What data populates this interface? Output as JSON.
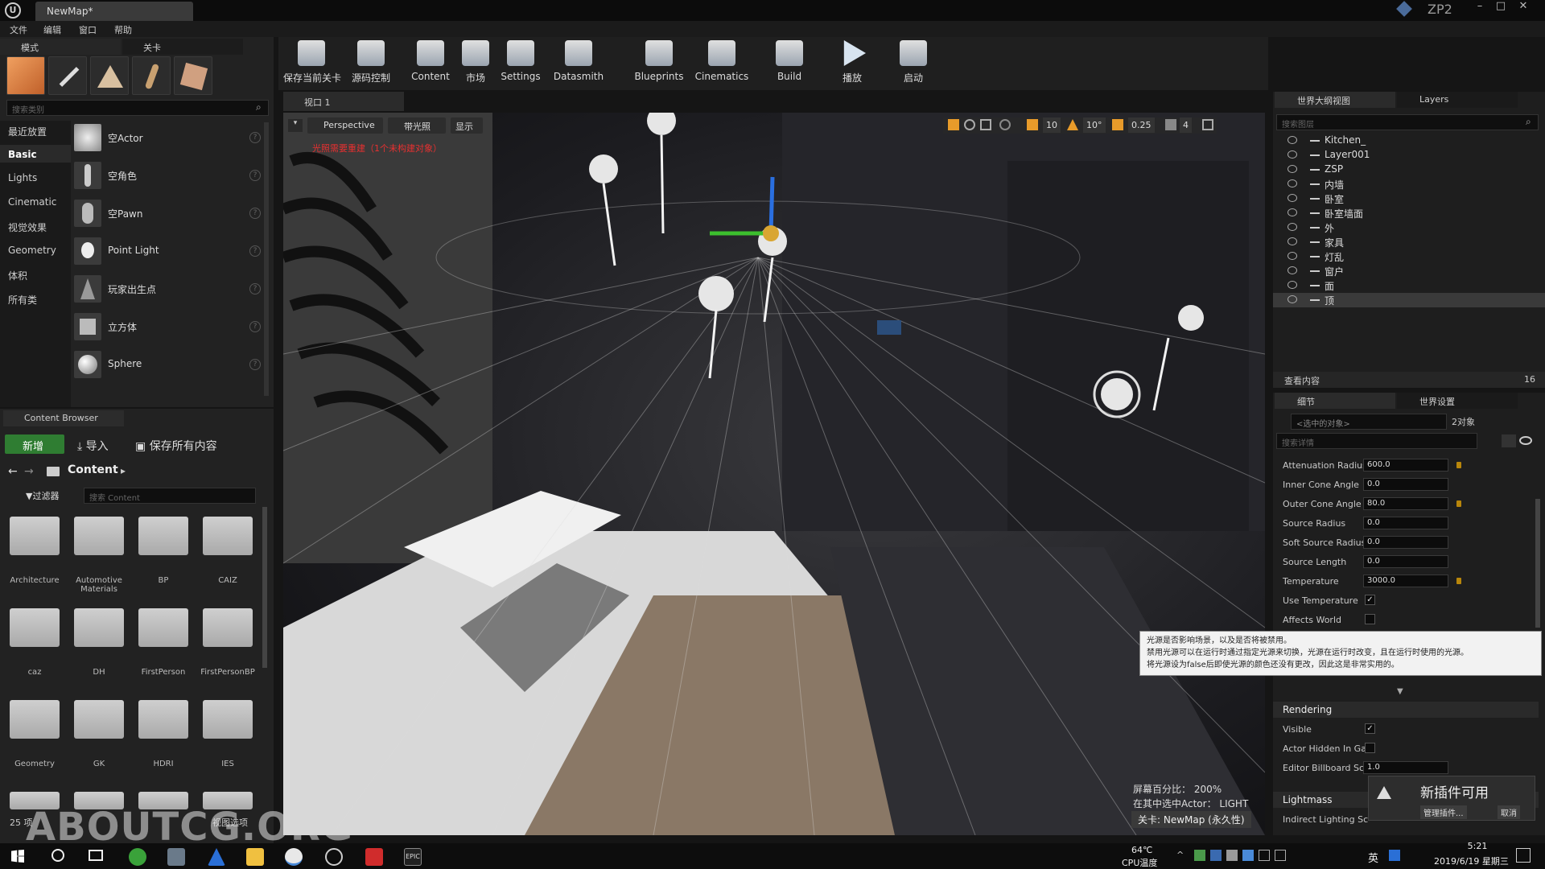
{
  "app": {
    "tab_title": "NewMap*",
    "corner_label": "ZP2"
  },
  "menu": [
    "文件",
    "编辑",
    "窗口",
    "帮助"
  ],
  "modes": {
    "tab_modes": "模式",
    "tab_levels": "关卡",
    "search_placeholder": "搜索类别",
    "categories": [
      "最近放置",
      "Basic",
      "Lights",
      "Cinematic",
      "视觉效果",
      "Geometry",
      "体积",
      "所有类"
    ],
    "items": [
      "空Actor",
      "空角色",
      "空Pawn",
      "Point Light",
      "玩家出生点",
      "立方体",
      "Sphere"
    ]
  },
  "toolbar": {
    "buttons": [
      "保存当前关卡",
      "源码控制",
      "Content",
      "市场",
      "Settings",
      "Datasmith",
      "Blueprints",
      "Cinematics",
      "Build",
      "播放",
      "启动"
    ]
  },
  "content_browser": {
    "title": "Content Browser",
    "add_new": "新增",
    "import": "导入",
    "save_all": "保存所有内容",
    "path": "Content",
    "filters": "过滤器",
    "search_placeholder": "搜索 Content",
    "folders": [
      "Architecture",
      "Automotive Materials",
      "BP",
      "CAIZ",
      "caz",
      "DH",
      "FirstPerson",
      "FirstPersonBP",
      "Geometry",
      "GK",
      "HDRI",
      "IES"
    ],
    "item_count": "25 项",
    "view_options": "视图选项"
  },
  "viewport": {
    "tab": "视口 1",
    "perspective": "Perspective",
    "lit": "带光照",
    "show": "显示",
    "warning": "光照需要重建（1个未构建对象）",
    "grid_snap": "10",
    "rot_snap": "10°",
    "scale_snap": "0.25",
    "cam_speed": "4",
    "screen_percentage": "屏幕百分比： 200%",
    "selected": "在其中选中Actor： LIGHT",
    "level": "关卡: NewMap (永久性)"
  },
  "outliner": {
    "tab_outliner": "世界大纲视图",
    "tab_layers": "Layers",
    "search_placeholder": "搜索图层",
    "items": [
      "Kitchen_",
      "Layer001",
      "ZSP",
      "内墙",
      "卧室",
      "卧室墙面",
      "外",
      "家具",
      "灯乱",
      "窗户",
      "面",
      "顶"
    ],
    "view_content": "查看内容",
    "count": "16"
  },
  "details": {
    "tab_details": "细节",
    "tab_world": "世界设置",
    "selection": "<选中的对象>",
    "selection_count": "2对象",
    "search_placeholder": "搜索详情",
    "properties": [
      {
        "label": "Attenuation Radius",
        "value": "600.0"
      },
      {
        "label": "Inner Cone Angle",
        "value": "0.0"
      },
      {
        "label": "Outer Cone Angle",
        "value": "80.0"
      },
      {
        "label": "Source Radius",
        "value": "0.0"
      },
      {
        "label": "Soft Source Radius",
        "value": "0.0"
      },
      {
        "label": "Source Length",
        "value": "0.0"
      },
      {
        "label": "Temperature",
        "value": "3000.0"
      }
    ],
    "use_temperature": "Use Temperature",
    "affects_world": "Affects World",
    "tooltip_line1": "光源是否影响场景，以及是否将被禁用。",
    "tooltip_line2": "禁用光源可以在运行时通过指定光源来切换，光源在运行时改变，且在运行时使用的光源。",
    "tooltip_line3": "将光源设为false后即使光源的颜色还没有更改，因此这是非常实用的。",
    "rendering": "Rendering",
    "visible": "Visible",
    "actor_hidden": "Actor Hidden In Gar",
    "billboard_scale": "Editor Billboard Sc",
    "billboard_value": "1.0",
    "lightmass": "Lightmass",
    "indirect_lighting": "Indirect Lighting Sc"
  },
  "notification": {
    "title": "新插件可用",
    "manage": "管理插件...",
    "cancel": "取消"
  },
  "watermark": "ABOUTCG.ORG",
  "taskbar": {
    "temp": "64℃",
    "temp_label": "CPU温度",
    "time": "5:21",
    "date": "2019/6/19 星期三",
    "ime": "英"
  }
}
